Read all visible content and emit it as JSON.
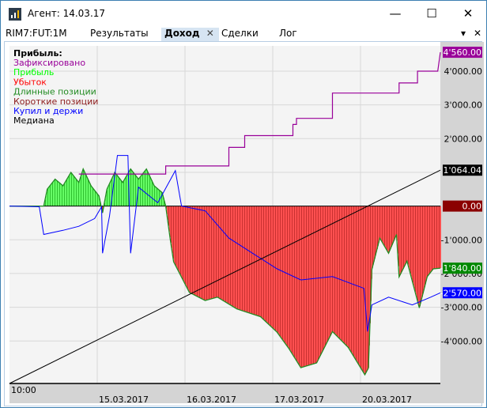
{
  "window": {
    "title": "Агент: 14.03.17",
    "minimize": "—",
    "maximize": "☐",
    "close": "✕"
  },
  "tabs": {
    "instrument": "RIM7:FUT:1M",
    "items": [
      {
        "label": "Результаты"
      },
      {
        "label": "Доход",
        "active": true
      },
      {
        "label": "Сделки"
      },
      {
        "label": "Лог"
      }
    ],
    "close": "✕",
    "menu": "▾",
    "panel_close": "✕"
  },
  "legend": {
    "title": "Прибыль:",
    "items": [
      {
        "label": "Зафиксировано",
        "color": "#990099"
      },
      {
        "label": "Прибыль",
        "color": "#00ff00"
      },
      {
        "label": "Убыток",
        "color": "#ff0000"
      },
      {
        "label": "Длинные позиции",
        "color": "#228b22"
      },
      {
        "label": "Короткие позиции",
        "color": "#8b1a1a"
      },
      {
        "label": "Купил и держи",
        "color": "#0000ff"
      },
      {
        "label": "Медиана",
        "color": "#000000"
      }
    ]
  },
  "chart_data": {
    "type": "line",
    "x_unit": "days since 14.03.2017 10:00",
    "xlim": [
      0,
      4.91
    ],
    "ylim": [
      -5260,
      4750
    ],
    "x_tick_labels": [
      {
        "x": 0,
        "label": "10:00"
      },
      {
        "x": 1,
        "label": "15.03.2017"
      },
      {
        "x": 2,
        "label": "16.03.2017"
      },
      {
        "x": 3,
        "label": "17.03.2017"
      },
      {
        "x": 4,
        "label": "20.03.2017"
      }
    ],
    "y_ticks": [
      4000,
      3000,
      2000,
      1000,
      -1000,
      -2000,
      -3000,
      -4000
    ],
    "y_tick_labels": [
      "4'000.00",
      "3'000.00",
      "2'000.00",
      "1'000.00",
      "-1'000.00",
      "-2'000.00",
      "-3'000.00",
      "-4'000.00"
    ],
    "badges": [
      {
        "value": 4560,
        "label": "4'560.00",
        "color": "#990099"
      },
      {
        "value": 1064.04,
        "label": "1'064.04",
        "color": "#000000"
      },
      {
        "value": 0,
        "label": "0.00",
        "color": "#8b0000"
      },
      {
        "value": -1840,
        "label": "-1'840.00",
        "color": "#008800"
      },
      {
        "value": -2570,
        "label": "-2'570.00",
        "color": "#0000ff"
      }
    ],
    "series": [
      {
        "name": "Прибыль",
        "points": [
          [
            0,
            0
          ],
          [
            0.39,
            0
          ],
          [
            0.43,
            500
          ],
          [
            0.52,
            800
          ],
          [
            0.61,
            600
          ],
          [
            0.7,
            1000
          ],
          [
            0.79,
            700
          ],
          [
            0.84,
            1100
          ],
          [
            0.93,
            600
          ],
          [
            1.02,
            300
          ],
          [
            1.06,
            -200
          ],
          [
            1.11,
            500
          ],
          [
            1.2,
            1000
          ],
          [
            1.29,
            700
          ],
          [
            1.38,
            1100
          ],
          [
            1.47,
            800
          ],
          [
            1.56,
            1100
          ],
          [
            1.65,
            600
          ],
          [
            1.74,
            400
          ],
          [
            1.78,
            0
          ],
          [
            1.83,
            -950
          ],
          [
            1.87,
            -1650
          ],
          [
            2.05,
            -2560
          ],
          [
            2.23,
            -2800
          ],
          [
            2.37,
            -2700
          ],
          [
            2.59,
            -3050
          ],
          [
            2.86,
            -3280
          ],
          [
            3.05,
            -3740
          ],
          [
            3.18,
            -4210
          ],
          [
            3.32,
            -4790
          ],
          [
            3.5,
            -4650
          ],
          [
            3.68,
            -3720
          ],
          [
            3.86,
            -4190
          ],
          [
            4.05,
            -5000
          ],
          [
            4.09,
            -4800
          ],
          [
            4.13,
            -1880
          ],
          [
            4.22,
            -950
          ],
          [
            4.32,
            -1400
          ],
          [
            4.41,
            -840
          ],
          [
            4.44,
            -2100
          ],
          [
            4.53,
            -1630
          ],
          [
            4.67,
            -3020
          ],
          [
            4.76,
            -2090
          ],
          [
            4.83,
            -1860
          ],
          [
            4.91,
            -1840
          ]
        ]
      },
      {
        "name": "Купил и держи",
        "points": [
          [
            0,
            0
          ],
          [
            0.34,
            -20
          ],
          [
            0.39,
            -840
          ],
          [
            0.61,
            -720
          ],
          [
            0.79,
            -600
          ],
          [
            0.97,
            -370
          ],
          [
            1.05,
            -20
          ],
          [
            1.06,
            -1400
          ],
          [
            1.14,
            -300
          ],
          [
            1.23,
            1500
          ],
          [
            1.35,
            1500
          ],
          [
            1.38,
            -1400
          ],
          [
            1.47,
            560
          ],
          [
            1.69,
            100
          ],
          [
            1.89,
            1050
          ],
          [
            1.96,
            0
          ],
          [
            2.23,
            -140
          ],
          [
            2.5,
            -950
          ],
          [
            2.77,
            -1400
          ],
          [
            3.05,
            -1860
          ],
          [
            3.32,
            -2190
          ],
          [
            3.68,
            -2090
          ],
          [
            4.04,
            -2440
          ],
          [
            4.08,
            -3720
          ],
          [
            4.13,
            -2930
          ],
          [
            4.32,
            -2700
          ],
          [
            4.59,
            -2930
          ],
          [
            4.8,
            -2700
          ],
          [
            4.91,
            -2570
          ]
        ]
      },
      {
        "name": "Зафиксировано",
        "points": [
          [
            0.79,
            950
          ],
          [
            1.78,
            950
          ],
          [
            1.78,
            1190
          ],
          [
            2.5,
            1190
          ],
          [
            2.5,
            1740
          ],
          [
            2.68,
            1740
          ],
          [
            2.68,
            2090
          ],
          [
            3.23,
            2090
          ],
          [
            3.23,
            2420
          ],
          [
            3.27,
            2420
          ],
          [
            3.27,
            2600
          ],
          [
            3.68,
            2600
          ],
          [
            3.68,
            3350
          ],
          [
            4.44,
            3350
          ],
          [
            4.44,
            3650
          ],
          [
            4.65,
            3650
          ],
          [
            4.65,
            4000
          ],
          [
            4.88,
            4000
          ],
          [
            4.91,
            4560
          ]
        ]
      },
      {
        "name": "Медиана",
        "points": [
          [
            0,
            -5260
          ],
          [
            4.91,
            1064.04
          ]
        ]
      }
    ]
  }
}
